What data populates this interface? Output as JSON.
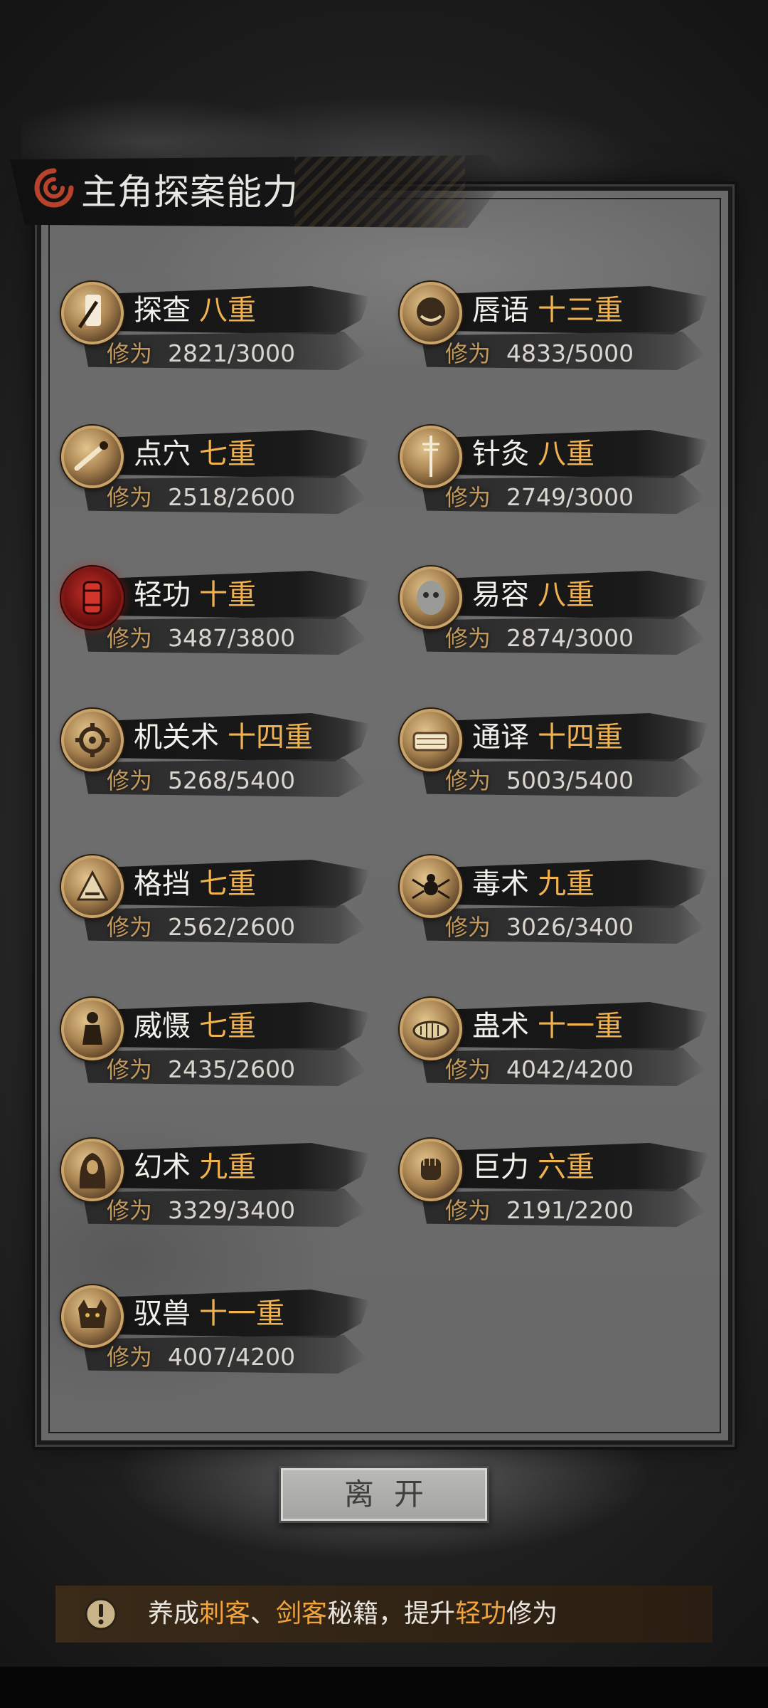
{
  "title": "主角探案能力",
  "skills": [
    {
      "name": "探查",
      "level": "八重",
      "cult_label": "修为",
      "cult": "2821/3000",
      "icon": "brush-scroll-icon"
    },
    {
      "name": "唇语",
      "level": "十三重",
      "cult_label": "修为",
      "cult": "4833/5000",
      "icon": "face-icon"
    },
    {
      "name": "点穴",
      "level": "七重",
      "cult_label": "修为",
      "cult": "2518/2600",
      "icon": "finger-strike-icon"
    },
    {
      "name": "针灸",
      "level": "八重",
      "cult_label": "修为",
      "cult": "2749/3000",
      "icon": "needle-icon"
    },
    {
      "name": "轻功",
      "level": "十重",
      "cult_label": "修为",
      "cult": "3487/3800",
      "icon": "red-lantern-icon"
    },
    {
      "name": "易容",
      "level": "八重",
      "cult_label": "修为",
      "cult": "2874/3000",
      "icon": "mask-icon"
    },
    {
      "name": "机关术",
      "level": "十四重",
      "cult_label": "修为",
      "cult": "5268/5400",
      "icon": "gear-icon"
    },
    {
      "name": "通译",
      "level": "十四重",
      "cult_label": "修为",
      "cult": "5003/5400",
      "icon": "scroll-icon"
    },
    {
      "name": "格挡",
      "level": "七重",
      "cult_label": "修为",
      "cult": "2562/2600",
      "icon": "shield-arm-icon"
    },
    {
      "name": "毒术",
      "level": "九重",
      "cult_label": "修为",
      "cult": "3026/3400",
      "icon": "spider-icon"
    },
    {
      "name": "威慑",
      "level": "七重",
      "cult_label": "修为",
      "cult": "2435/2600",
      "icon": "warrior-icon"
    },
    {
      "name": "蛊术",
      "level": "十一重",
      "cult_label": "修为",
      "cult": "4042/4200",
      "icon": "larva-icon"
    },
    {
      "name": "幻术",
      "level": "九重",
      "cult_label": "修为",
      "cult": "3329/3400",
      "icon": "hooded-figure-icon"
    },
    {
      "name": "巨力",
      "level": "六重",
      "cult_label": "修为",
      "cult": "2191/2200",
      "icon": "fist-icon"
    },
    {
      "name": "驭兽",
      "level": "十一重",
      "cult_label": "修为",
      "cult": "4007/4200",
      "icon": "beast-icon"
    }
  ],
  "leave_button": "离开",
  "hint": {
    "parts": [
      "养成",
      "刺客",
      "、",
      "剑客",
      "秘籍，提升",
      "轻功",
      "修为"
    ],
    "icon": "exclamation-icon"
  },
  "colors": {
    "level": "#f0b251",
    "highlight": "#f2a43a",
    "cultivation_label": "#c49a5c"
  }
}
